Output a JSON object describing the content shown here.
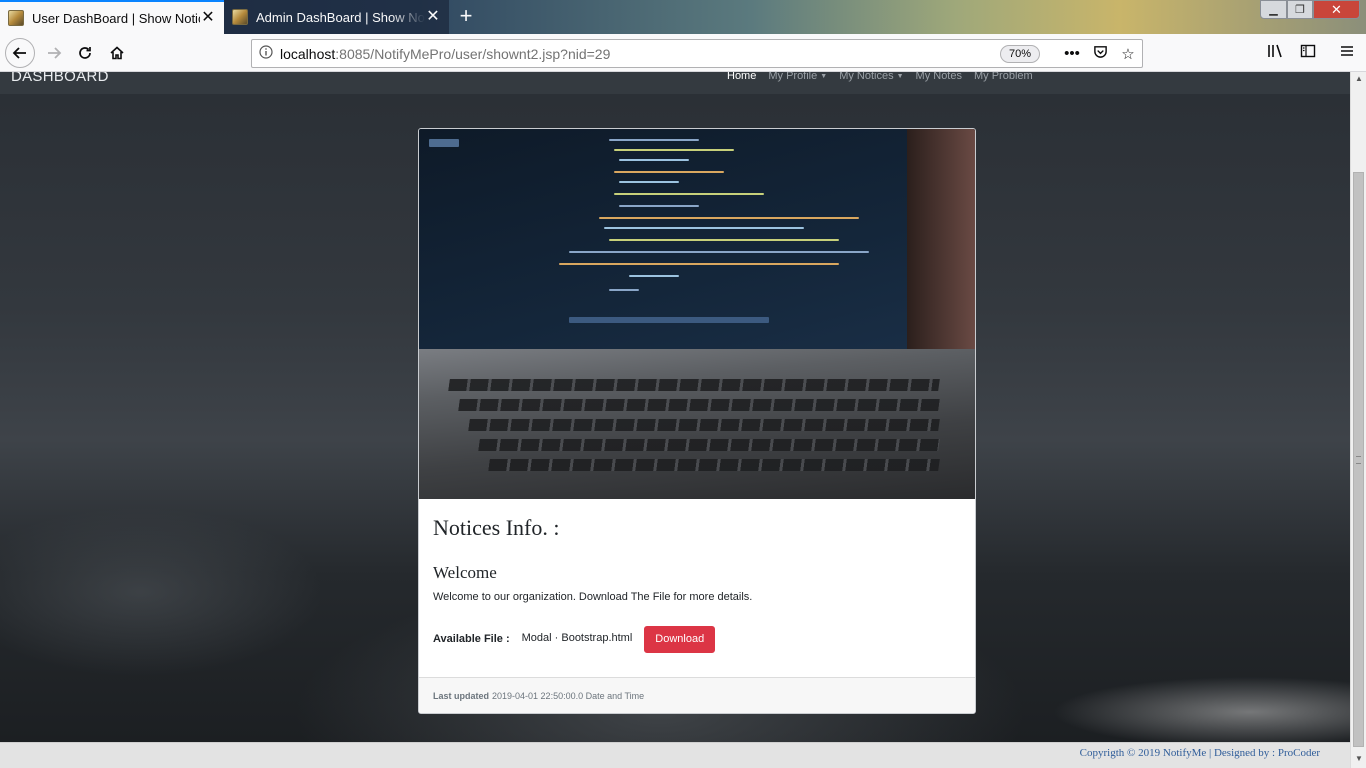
{
  "browser": {
    "tabs": [
      {
        "title": "User DashBoard | Show Notice",
        "active": true
      },
      {
        "title": "Admin DashBoard | Show Notice",
        "active": false
      }
    ],
    "new_tab_glyph": "+",
    "close_glyph": "✕",
    "url_host": "localhost",
    "url_rest": ":8085/NotifyMePro/user/shownt2.jsp?nid=29",
    "zoom": "70%",
    "icons": [
      "back-arrow-icon",
      "forward-arrow-icon",
      "reload-icon",
      "home-icon",
      "info-icon",
      "more-actions-icon",
      "pocket-icon",
      "bookmark-star-icon",
      "library-icon",
      "sidebar-icon",
      "hamburger-menu-icon"
    ],
    "window_controls": {
      "minimize": "▁",
      "maximize": "❐",
      "close": "✕"
    }
  },
  "site_nav": {
    "brand": "DASHBOARD",
    "items": [
      {
        "label": "Home",
        "active": true,
        "dropdown": false
      },
      {
        "label": "My Profile",
        "active": false,
        "dropdown": true
      },
      {
        "label": "My Notices",
        "active": false,
        "dropdown": true
      },
      {
        "label": "My Notes",
        "active": false,
        "dropdown": false
      },
      {
        "label": "My Problem",
        "active": false,
        "dropdown": false
      }
    ]
  },
  "card": {
    "title": "Notices Info. :",
    "subject": "Welcome",
    "text": "Welcome to our organization. Download The File for more details.",
    "file_label": "Available File :",
    "file_name": "Modal · Bootstrap.html",
    "download_label": "Download",
    "footer_label": "Last updated",
    "footer_value": "2019-04-01 22:50:00.0 Date and Time"
  },
  "footer": {
    "text": "Copyrigth © 2019 NotifyMe | Designed by : ProCoder"
  },
  "colors": {
    "accent": "#0a84ff",
    "download_button": "#dc3545",
    "site_nav": "#343a40",
    "footer_link": "#2f5d9a"
  }
}
